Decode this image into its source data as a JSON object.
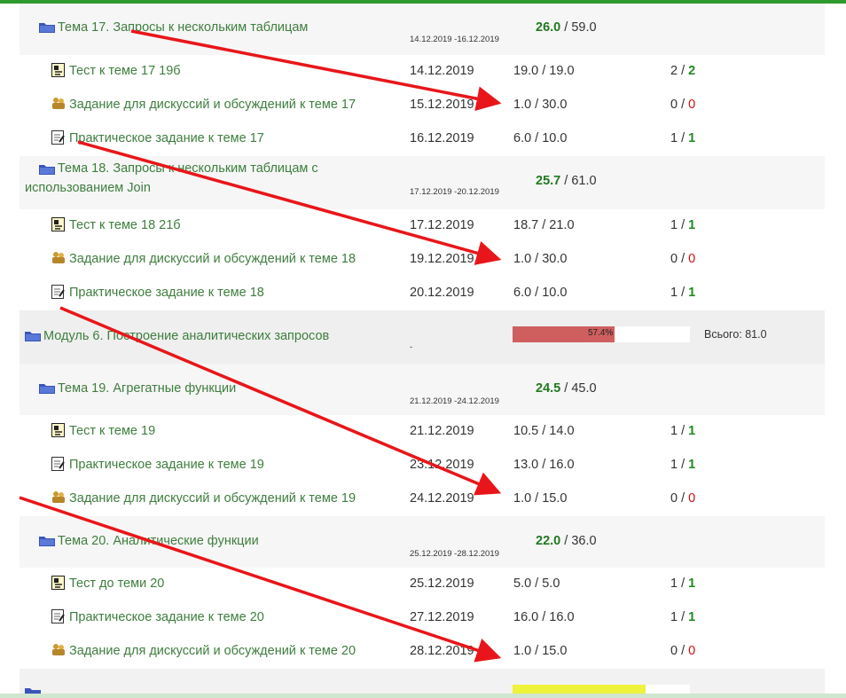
{
  "colors": {
    "accent_green": "#2e9a2e",
    "link_green": "#3e7e3e",
    "score_green": "#1f7a1f",
    "zero_red": "#d01010",
    "arrow_red": "#e8161a",
    "module_bar": "#cf5f5f",
    "partial_bar": "#eef23a"
  },
  "rows": [
    {
      "name": "Тема 17. Запросы к нескольким таблицам",
      "range": "14.12.2019 -16.12.2019",
      "score_bold": "26.0",
      "score_rest": " / 59.0",
      "icon": "folder-icon"
    },
    {
      "name": "Тест к теме 17 19б",
      "date": "14.12.2019",
      "score": "19.0 / 19.0",
      "att_a": "2 / ",
      "att_b": "2",
      "icon": "quiz-icon"
    },
    {
      "name": "Задание для дискуссий и обсуждений к теме 17",
      "date": "15.12.2019",
      "score": "1.0 / 30.0",
      "att_a": "0 / ",
      "att_b": "0",
      "icon": "forum-icon"
    },
    {
      "name": "Практическое задание к теме 17",
      "date": "16.12.2019",
      "score": "6.0 / 10.0",
      "att_a": "1 / ",
      "att_b": "1",
      "icon": "assignment-icon"
    },
    {
      "name": "Тема 18. Запросы к нескольким таблицам с использованием Join",
      "range": "17.12.2019 -20.12.2019",
      "score_bold": "25.7",
      "score_rest": " / 61.0",
      "icon": "folder-icon"
    },
    {
      "name": "Тест к теме 18 21б",
      "date": "17.12.2019",
      "score": "18.7 / 21.0",
      "att_a": "1 / ",
      "att_b": "1",
      "icon": "quiz-icon"
    },
    {
      "name": "Задание для дискуссий и обсуждений к теме 18",
      "date": "19.12.2019",
      "score": "1.0 / 30.0",
      "att_a": "0 / ",
      "att_b": "0",
      "icon": "forum-icon"
    },
    {
      "name": "Практическое задание к теме 18",
      "date": "20.12.2019",
      "score": "6.0 / 10.0",
      "att_a": "1 / ",
      "att_b": "1",
      "icon": "assignment-icon"
    },
    {
      "name": "Модуль 6. Построение аналитических запросов",
      "range": "-",
      "percent": "57.4%",
      "progress": 0.574,
      "total": "Всього: 81.0",
      "icon": "folder-icon"
    },
    {
      "name": "Тема 19. Агрегатные функции",
      "range": "21.12.2019 -24.12.2019",
      "score_bold": "24.5",
      "score_rest": " / 45.0",
      "icon": "folder-icon"
    },
    {
      "name": "Тест к теме 19",
      "date": "21.12.2019",
      "score": "10.5 / 14.0",
      "att_a": "1 / ",
      "att_b": "1",
      "icon": "quiz-icon"
    },
    {
      "name": "Практическое задание к теме 19",
      "date": "23.12.2019",
      "score": "13.0 / 16.0",
      "att_a": "1 / ",
      "att_b": "1",
      "icon": "assignment-icon"
    },
    {
      "name": "Задание для дискуссий и обсуждений к теме 19",
      "date": "24.12.2019",
      "score": "1.0 / 15.0",
      "att_a": "0 / ",
      "att_b": "0",
      "icon": "forum-icon"
    },
    {
      "name": "Тема 20. Аналитические функции",
      "range": "25.12.2019 -28.12.2019",
      "score_bold": "22.0",
      "score_rest": " / 36.0",
      "icon": "folder-icon"
    },
    {
      "name": "Тест до теми 20",
      "date": "25.12.2019",
      "score": "5.0 / 5.0",
      "att_a": "1 / ",
      "att_b": "1",
      "icon": "quiz-icon"
    },
    {
      "name": "Практическое задание к теме 20",
      "date": "27.12.2019",
      "score": "16.0 / 16.0",
      "att_a": "1 / ",
      "att_b": "1",
      "icon": "assignment-icon"
    },
    {
      "name": "Задание для дискуссий и обсуждений к теме 20",
      "date": "28.12.2019",
      "score": "1.0 / 15.0",
      "att_a": "0 / ",
      "att_b": "0",
      "icon": "forum-icon"
    },
    {
      "progress": 0.75,
      "icon": "folder-icon"
    }
  ],
  "annotation": {
    "arrow_count": 4,
    "arrow_icon": "red-arrow-icon"
  }
}
